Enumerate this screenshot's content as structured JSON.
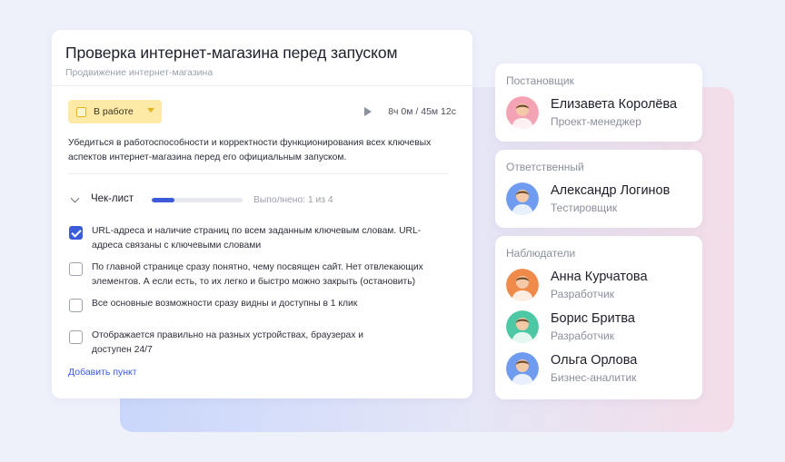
{
  "task": {
    "title": "Проверка интернет-магазина перед запуском",
    "project": "Продвижение интернет-магазина",
    "status": "В работе",
    "timer": "8ч 0м / 45м 12с",
    "description": "Убедиться в работоспособности и корректности функционирования всех ключевых аспектов интернет-магазина перед его официальным запуском.",
    "checklist": {
      "title": "Чек-лист",
      "progress_fraction": 0.25,
      "done_text": "Выполнено: 1 из 4",
      "items": [
        {
          "text": "URL-адреса и наличие страниц по всем заданным ключевым словам. URL-адреса связаны с ключевыми словами",
          "checked": true
        },
        {
          "text": "По главной странице сразу понятно, чему посвящен сайт. Нет отвлекающих элементов. А если есть, то их легко и быстро можно закрыть (остановить)",
          "checked": false
        },
        {
          "text": "Все основные возможности сразу видны и доступны в 1 клик",
          "checked": false
        },
        {
          "text": "Отображается правильно на разных устройствах, браузерах и доступен 24/7",
          "checked": false
        }
      ],
      "add_label": "Добавить пункт"
    }
  },
  "assigner": {
    "title": "Постановщик",
    "people": [
      {
        "name": "Елизавета Королёва",
        "role": "Проект-менеджер",
        "avatar_color": "#f4a3b4"
      }
    ]
  },
  "responsible": {
    "title": "Ответственный",
    "people": [
      {
        "name": "Александр Логинов",
        "role": "Тестировщик",
        "avatar_color": "#6f9bf0"
      }
    ]
  },
  "watchers": {
    "title": "Наблюдатели",
    "people": [
      {
        "name": "Анна Курчатова",
        "role": "Разработчик",
        "avatar_color": "#f08a4b"
      },
      {
        "name": "Борис Бритва",
        "role": "Разработчик",
        "avatar_color": "#4cc9a4"
      },
      {
        "name": "Ольга Орлова",
        "role": "Бизнес-аналитик",
        "avatar_color": "#6f9bf0"
      }
    ]
  },
  "colors": {
    "accent": "#3b5bdb",
    "status_bg": "#fdeaa7",
    "status_border": "#e8b320"
  }
}
